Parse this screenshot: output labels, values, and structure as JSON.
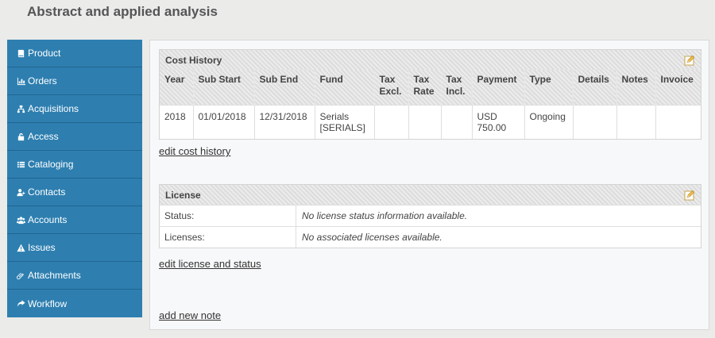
{
  "page": {
    "title": "Abstract and applied analysis"
  },
  "sidebar": {
    "items": [
      {
        "label": "Product",
        "icon": "book-icon"
      },
      {
        "label": "Orders",
        "icon": "bar-chart-icon"
      },
      {
        "label": "Acquisitions",
        "icon": "sitemap-icon"
      },
      {
        "label": "Access",
        "icon": "lock-icon"
      },
      {
        "label": "Cataloging",
        "icon": "list-icon"
      },
      {
        "label": "Contacts",
        "icon": "user-plus-icon"
      },
      {
        "label": "Accounts",
        "icon": "users-icon"
      },
      {
        "label": "Issues",
        "icon": "warning-icon"
      },
      {
        "label": "Attachments",
        "icon": "paperclip-icon"
      },
      {
        "label": "Workflow",
        "icon": "share-arrow-icon"
      }
    ]
  },
  "cost_history": {
    "title": "Cost History",
    "columns": [
      "Year",
      "Sub Start",
      "Sub End",
      "Fund",
      "Tax Excl.",
      "Tax Rate",
      "Tax Incl.",
      "Payment",
      "Type",
      "Details",
      "Notes",
      "Invoice"
    ],
    "rows": [
      [
        "2018",
        "01/01/2018",
        "12/31/2018",
        "Serials [SERIALS]",
        "",
        "",
        "",
        "USD 750.00",
        "Ongoing",
        "",
        "",
        ""
      ]
    ],
    "edit_link": "edit cost history"
  },
  "license": {
    "title": "License",
    "status_label": "Status:",
    "status_value": "No license status information available.",
    "licenses_label": "Licenses:",
    "licenses_value": "No associated licenses available.",
    "edit_link": "edit license and status"
  },
  "notes": {
    "add_link": "add new note"
  },
  "colors": {
    "sidebar": "#2e7fb0",
    "header_bg": "#dcdcdc",
    "background": "#ebebea"
  }
}
